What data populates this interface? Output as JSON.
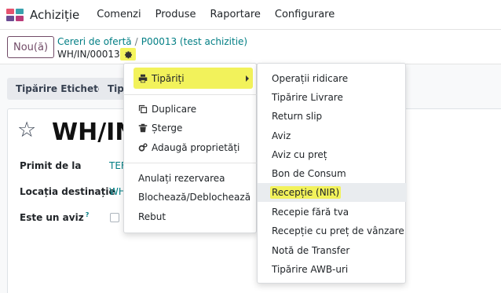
{
  "navbar": {
    "app_name": "Achiziție",
    "menu": [
      "Comenzi",
      "Produse",
      "Raportare",
      "Configurare"
    ],
    "app_icon_colors": [
      "#e5536f",
      "#3aa1ae",
      "#6a4c93",
      "#bb3b79"
    ]
  },
  "control": {
    "new_button": "Nou(ă)",
    "breadcrumb": [
      "Cereri de ofertă",
      "P00013 (test achizitie)"
    ],
    "breadcrumb_sep": "/",
    "record_name": "WH/IN/00013",
    "gear_icon": "gear-icon"
  },
  "statusbar": {
    "buttons": [
      "Tipărire Etichete",
      "Tipă"
    ]
  },
  "form": {
    "title": "WH/IN",
    "fields": [
      {
        "label": "Primit de la",
        "value": "TEF"
      },
      {
        "label": "Locația destinație",
        "value": "WH"
      },
      {
        "label": "Este un aviz",
        "help": "?"
      }
    ]
  },
  "gear_menu": {
    "print": {
      "label": "Tipăriți",
      "icon": "printer-icon"
    },
    "duplicate": {
      "label": "Duplicare",
      "icon": "copy-icon"
    },
    "delete": {
      "label": "Șterge",
      "icon": "trash-icon"
    },
    "add_props": {
      "label": "Adaugă proprietăți",
      "icon": "cogs-icon"
    },
    "actions": [
      "Anulați rezervarea",
      "Blochează/Deblochează",
      "Rebut"
    ]
  },
  "print_submenu": {
    "items": [
      "Operații ridicare",
      "Tipărire Livrare",
      "Return slip",
      "Aviz",
      "Aviz cu preț",
      "Bon de Consum",
      "Recepție (NIR)",
      "Recepie fără tva",
      "Recepție cu preț de vânzare",
      "Notă de Transfer",
      "Tipărire AWB-uri"
    ],
    "highlighted_index": 6
  },
  "colors": {
    "brand": "#714b67",
    "link": "#017e84",
    "highlight": "#f2f25b"
  }
}
